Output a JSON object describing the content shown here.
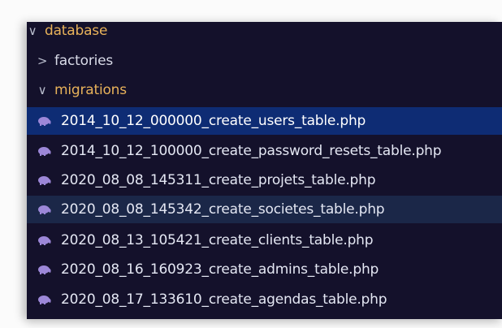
{
  "explorer": {
    "root": {
      "label": "database",
      "chevron": "✔"
    },
    "folders": [
      {
        "label": "factories",
        "chevron": ">"
      },
      {
        "label": "migrations",
        "chevron": "∨"
      }
    ],
    "files": [
      {
        "label": "2014_10_12_000000_create_users_table.php",
        "icon": "php-elephant-icon"
      },
      {
        "label": "2014_10_12_100000_create_password_resets_table.php",
        "icon": "php-elephant-icon"
      },
      {
        "label": "2020_08_08_145311_create_projets_table.php",
        "icon": "php-elephant-icon"
      },
      {
        "label": "2020_08_08_145342_create_societes_table.php",
        "icon": "php-elephant-icon"
      },
      {
        "label": "2020_08_13_105421_create_clients_table.php",
        "icon": "php-elephant-icon"
      },
      {
        "label": "2020_08_16_160923_create_admins_table.php",
        "icon": "php-elephant-icon"
      },
      {
        "label": "2020_08_17_133610_create_agendas_table.php",
        "icon": "php-elephant-icon"
      }
    ]
  },
  "colors": {
    "panel_bg": "#14112b",
    "selected_bg": "#0e2c74",
    "hover_bg": "#1b2748",
    "folder_text": "#e8b25a",
    "file_text": "#e4e7f3",
    "php_icon": "#9c87d8"
  }
}
